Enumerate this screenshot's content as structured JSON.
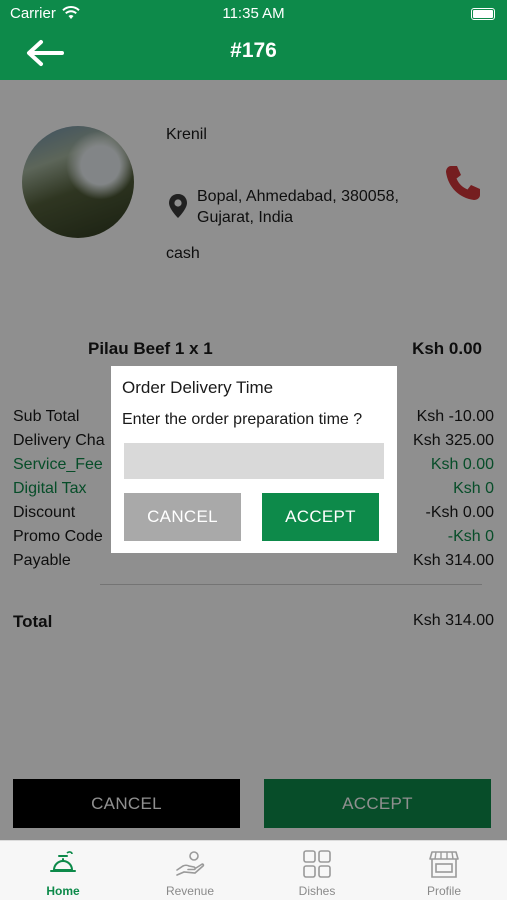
{
  "status_bar": {
    "carrier": "Carrier",
    "time": "11:35 AM"
  },
  "header": {
    "title": "#176"
  },
  "customer": {
    "name": "Krenil",
    "address": "Bopal, Ahmedabad, 380058, Gujarat, India",
    "payment_method": "cash"
  },
  "order_item": {
    "name": "Pilau Beef 1 x 1",
    "price": "Ksh 0.00"
  },
  "summary": {
    "sub_total": {
      "label": "Sub Total",
      "value": "Ksh -10.00"
    },
    "delivery": {
      "label": "Delivery Cha",
      "value": "Ksh 325.00"
    },
    "service_fee": {
      "label": "Service_Fee",
      "value": "Ksh 0.00"
    },
    "digital_tax": {
      "label": "Digital Tax",
      "value": "Ksh 0"
    },
    "discount": {
      "label": "Discount",
      "value": "-Ksh 0.00"
    },
    "promo_code": {
      "label": "Promo Code",
      "value": "-Ksh 0"
    },
    "payable": {
      "label": "Payable",
      "value": "Ksh 314.00"
    }
  },
  "total": {
    "label": "Total",
    "value": "Ksh 314.00"
  },
  "actions": {
    "cancel_label": "CANCEL",
    "accept_label": "ACCEPT"
  },
  "dialog": {
    "title": "Order Delivery Time",
    "message": "Enter the order preparation time ?",
    "input_value": "",
    "cancel_label": "CANCEL",
    "accept_label": "ACCEPT"
  },
  "tabs": [
    {
      "label": "Home",
      "icon": "food-tray-icon",
      "active": true
    },
    {
      "label": "Revenue",
      "icon": "hand-coin-icon",
      "active": false
    },
    {
      "label": "Dishes",
      "icon": "grid-icon",
      "active": false
    },
    {
      "label": "Profile",
      "icon": "storefront-icon",
      "active": false
    }
  ],
  "colors": {
    "brand": "#0d8a4a",
    "phone": "#d0363a",
    "dark_button": "#000000"
  }
}
